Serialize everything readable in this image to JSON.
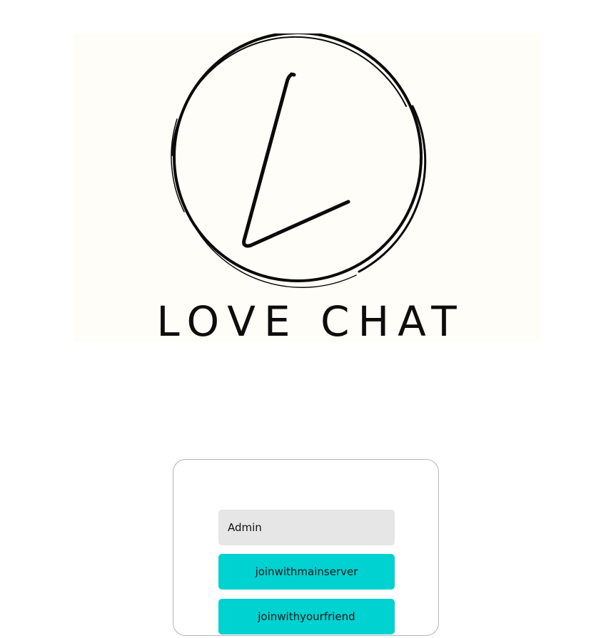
{
  "logo": {
    "brand_text": "LOVE CHAT",
    "monogram": "L",
    "background_color": "#fefdf7"
  },
  "join_form": {
    "username_value": "Admin",
    "join_main_label": "joinwithmainserver",
    "join_friend_label": "joinwithyourfriend",
    "button_color": "#00d1d1",
    "input_color": "#e6e6e6"
  }
}
